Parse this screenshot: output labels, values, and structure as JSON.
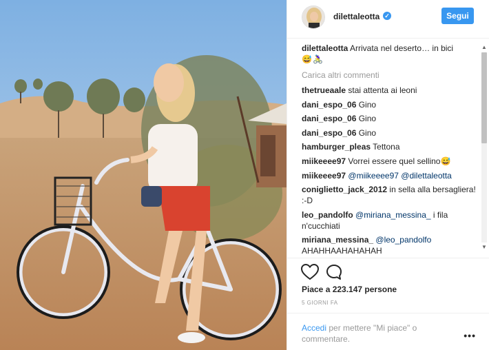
{
  "post": {
    "username": "dilettaleotta",
    "verified_mark": "✓",
    "follow_label": "Segui",
    "caption_user": "dilettaleotta",
    "caption_text": " Arrivata nel deserto… in bici",
    "caption_emoji": "😅🚴‍♀️",
    "load_more": "Carica altri commenti",
    "likes": "Piace a 223.147 persone",
    "timestamp": "5 GIORNI FA",
    "login_link": "Accedi",
    "login_rest": " per mettere \"Mi piace\" o commentare.",
    "more_glyph": "•••"
  },
  "comments": [
    {
      "user": "thetrueaale",
      "text": " stai attenta ai leoni"
    },
    {
      "user": "dani_espo_06",
      "text": " Gino"
    },
    {
      "user": "dani_espo_06",
      "text": " Gino"
    },
    {
      "user": "dani_espo_06",
      "text": " Gino"
    },
    {
      "user": "hamburger_pleas",
      "text": " Tettona"
    },
    {
      "user": "miikeeee97",
      "text": " Vorrei essere quel sellino😅"
    },
    {
      "user": "miikeeee97",
      "mention1": " @miikeeee97",
      "mention2": " @dilettaleotta"
    },
    {
      "user": "coniglietto_jack_2012",
      "text": " in sella alla bersagliera! :-D"
    },
    {
      "user": "leo_pandolfo",
      "mention1": " @miriana_messina_",
      "text": " i fila n'cucchiati"
    },
    {
      "user": "miriana_messina_",
      "mention1": " @leo_pandolfo",
      "text": " AHAHHAAHAHAHAH"
    }
  ],
  "icons": {
    "heart": "heart-icon",
    "comment": "comment-icon",
    "verified": "verified-badge-icon",
    "more": "more-options-icon",
    "scroll_up": "▲",
    "scroll_down": "▼"
  },
  "colors": {
    "accent": "#3897f0",
    "mention": "#003569",
    "muted": "#999999"
  }
}
